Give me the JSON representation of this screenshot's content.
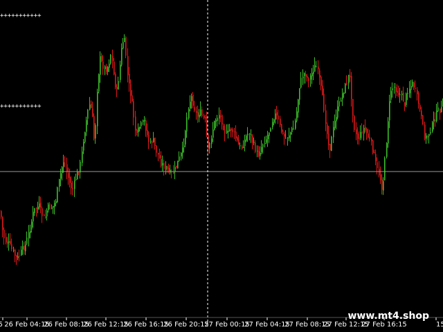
{
  "chart_data": {
    "type": "candlestick",
    "grid": false,
    "colors": {
      "background": "#000000",
      "bull": "#3cbf2a",
      "bear": "#e01818",
      "crosshair": "#ffffff",
      "hline": "#9a9a9a",
      "level_marker": "#ffffff"
    },
    "x_tick_labels": [
      "5",
      "26 Feb 04:15",
      "26 Feb 08:15",
      "26 Feb 12:15",
      "26 Feb 16:15",
      "26 Feb 20:15",
      "27 Feb 00:15",
      "27 Feb 04:15",
      "27 Feb 08:15",
      "27 Feb 12:15",
      "27 Feb 16:15",
      "15"
    ],
    "watermark": "www.mt4.shop",
    "level_markers": [
      {
        "symbol": "+"
      },
      {
        "symbol": "+"
      }
    ],
    "close_profile": [
      [
        0,
        305
      ],
      [
        4,
        340
      ],
      [
        8,
        350
      ],
      [
        12,
        352
      ],
      [
        16,
        360
      ],
      [
        20,
        368
      ],
      [
        24,
        375
      ],
      [
        28,
        368
      ],
      [
        32,
        360
      ],
      [
        36,
        355
      ],
      [
        40,
        340
      ],
      [
        44,
        325
      ],
      [
        48,
        305
      ],
      [
        52,
        300
      ],
      [
        56,
        298
      ],
      [
        60,
        310
      ],
      [
        64,
        318
      ],
      [
        68,
        300
      ],
      [
        72,
        300
      ],
      [
        76,
        298
      ],
      [
        80,
        290
      ],
      [
        84,
        265
      ],
      [
        88,
        245
      ],
      [
        92,
        230
      ],
      [
        96,
        250
      ],
      [
        100,
        265
      ],
      [
        104,
        275
      ],
      [
        108,
        260
      ],
      [
        112,
        248
      ],
      [
        116,
        235
      ],
      [
        120,
        200
      ],
      [
        124,
        175
      ],
      [
        128,
        150
      ],
      [
        132,
        160
      ],
      [
        136,
        210
      ],
      [
        140,
        120
      ],
      [
        144,
        85
      ],
      [
        148,
        95
      ],
      [
        152,
        100
      ],
      [
        156,
        95
      ],
      [
        160,
        75
      ],
      [
        164,
        110
      ],
      [
        168,
        135
      ],
      [
        172,
        100
      ],
      [
        176,
        60
      ],
      [
        180,
        60
      ],
      [
        184,
        115
      ],
      [
        188,
        135
      ],
      [
        192,
        165
      ],
      [
        196,
        200
      ],
      [
        200,
        185
      ],
      [
        204,
        180
      ],
      [
        208,
        175
      ],
      [
        212,
        195
      ],
      [
        216,
        210
      ],
      [
        220,
        200
      ],
      [
        224,
        215
      ],
      [
        228,
        225
      ],
      [
        232,
        235
      ],
      [
        236,
        240
      ],
      [
        240,
        245
      ],
      [
        244,
        250
      ],
      [
        248,
        252
      ],
      [
        252,
        245
      ],
      [
        256,
        235
      ],
      [
        260,
        225
      ],
      [
        264,
        215
      ],
      [
        268,
        180
      ],
      [
        272,
        150
      ],
      [
        276,
        140
      ],
      [
        280,
        155
      ],
      [
        284,
        170
      ],
      [
        288,
        160
      ],
      [
        292,
        170
      ],
      [
        296,
        175
      ],
      [
        300,
        220
      ],
      [
        304,
        200
      ],
      [
        308,
        180
      ],
      [
        312,
        170
      ],
      [
        316,
        165
      ],
      [
        320,
        175
      ],
      [
        324,
        190
      ],
      [
        328,
        195
      ],
      [
        332,
        185
      ],
      [
        336,
        190
      ],
      [
        340,
        200
      ],
      [
        344,
        210
      ],
      [
        348,
        215
      ],
      [
        352,
        205
      ],
      [
        356,
        195
      ],
      [
        360,
        190
      ],
      [
        364,
        205
      ],
      [
        368,
        215
      ],
      [
        372,
        225
      ],
      [
        376,
        215
      ],
      [
        380,
        205
      ],
      [
        384,
        200
      ],
      [
        388,
        190
      ],
      [
        392,
        175
      ],
      [
        396,
        165
      ],
      [
        400,
        170
      ],
      [
        404,
        185
      ],
      [
        408,
        195
      ],
      [
        412,
        200
      ],
      [
        416,
        195
      ],
      [
        420,
        190
      ],
      [
        424,
        185
      ],
      [
        428,
        160
      ],
      [
        432,
        125
      ],
      [
        436,
        110
      ],
      [
        440,
        105
      ],
      [
        444,
        115
      ],
      [
        448,
        110
      ],
      [
        452,
        100
      ],
      [
        456,
        95
      ],
      [
        460,
        110
      ],
      [
        464,
        135
      ],
      [
        468,
        160
      ],
      [
        472,
        195
      ],
      [
        476,
        215
      ],
      [
        480,
        190
      ],
      [
        484,
        170
      ],
      [
        488,
        155
      ],
      [
        492,
        140
      ],
      [
        496,
        130
      ],
      [
        500,
        120
      ],
      [
        504,
        105
      ],
      [
        508,
        150
      ],
      [
        512,
        190
      ],
      [
        516,
        200
      ],
      [
        520,
        195
      ],
      [
        524,
        185
      ],
      [
        528,
        190
      ],
      [
        532,
        200
      ],
      [
        536,
        210
      ],
      [
        540,
        225
      ],
      [
        544,
        245
      ],
      [
        548,
        255
      ],
      [
        552,
        275
      ],
      [
        556,
        225
      ],
      [
        560,
        170
      ],
      [
        564,
        130
      ],
      [
        568,
        125
      ],
      [
        572,
        130
      ],
      [
        576,
        135
      ],
      [
        580,
        140
      ],
      [
        584,
        150
      ],
      [
        588,
        130
      ],
      [
        592,
        125
      ],
      [
        596,
        120
      ],
      [
        600,
        135
      ],
      [
        604,
        150
      ],
      [
        608,
        170
      ],
      [
        612,
        195
      ],
      [
        616,
        200
      ],
      [
        620,
        190
      ],
      [
        624,
        180
      ],
      [
        628,
        170
      ],
      [
        632,
        160
      ],
      [
        636,
        158
      ]
    ]
  }
}
